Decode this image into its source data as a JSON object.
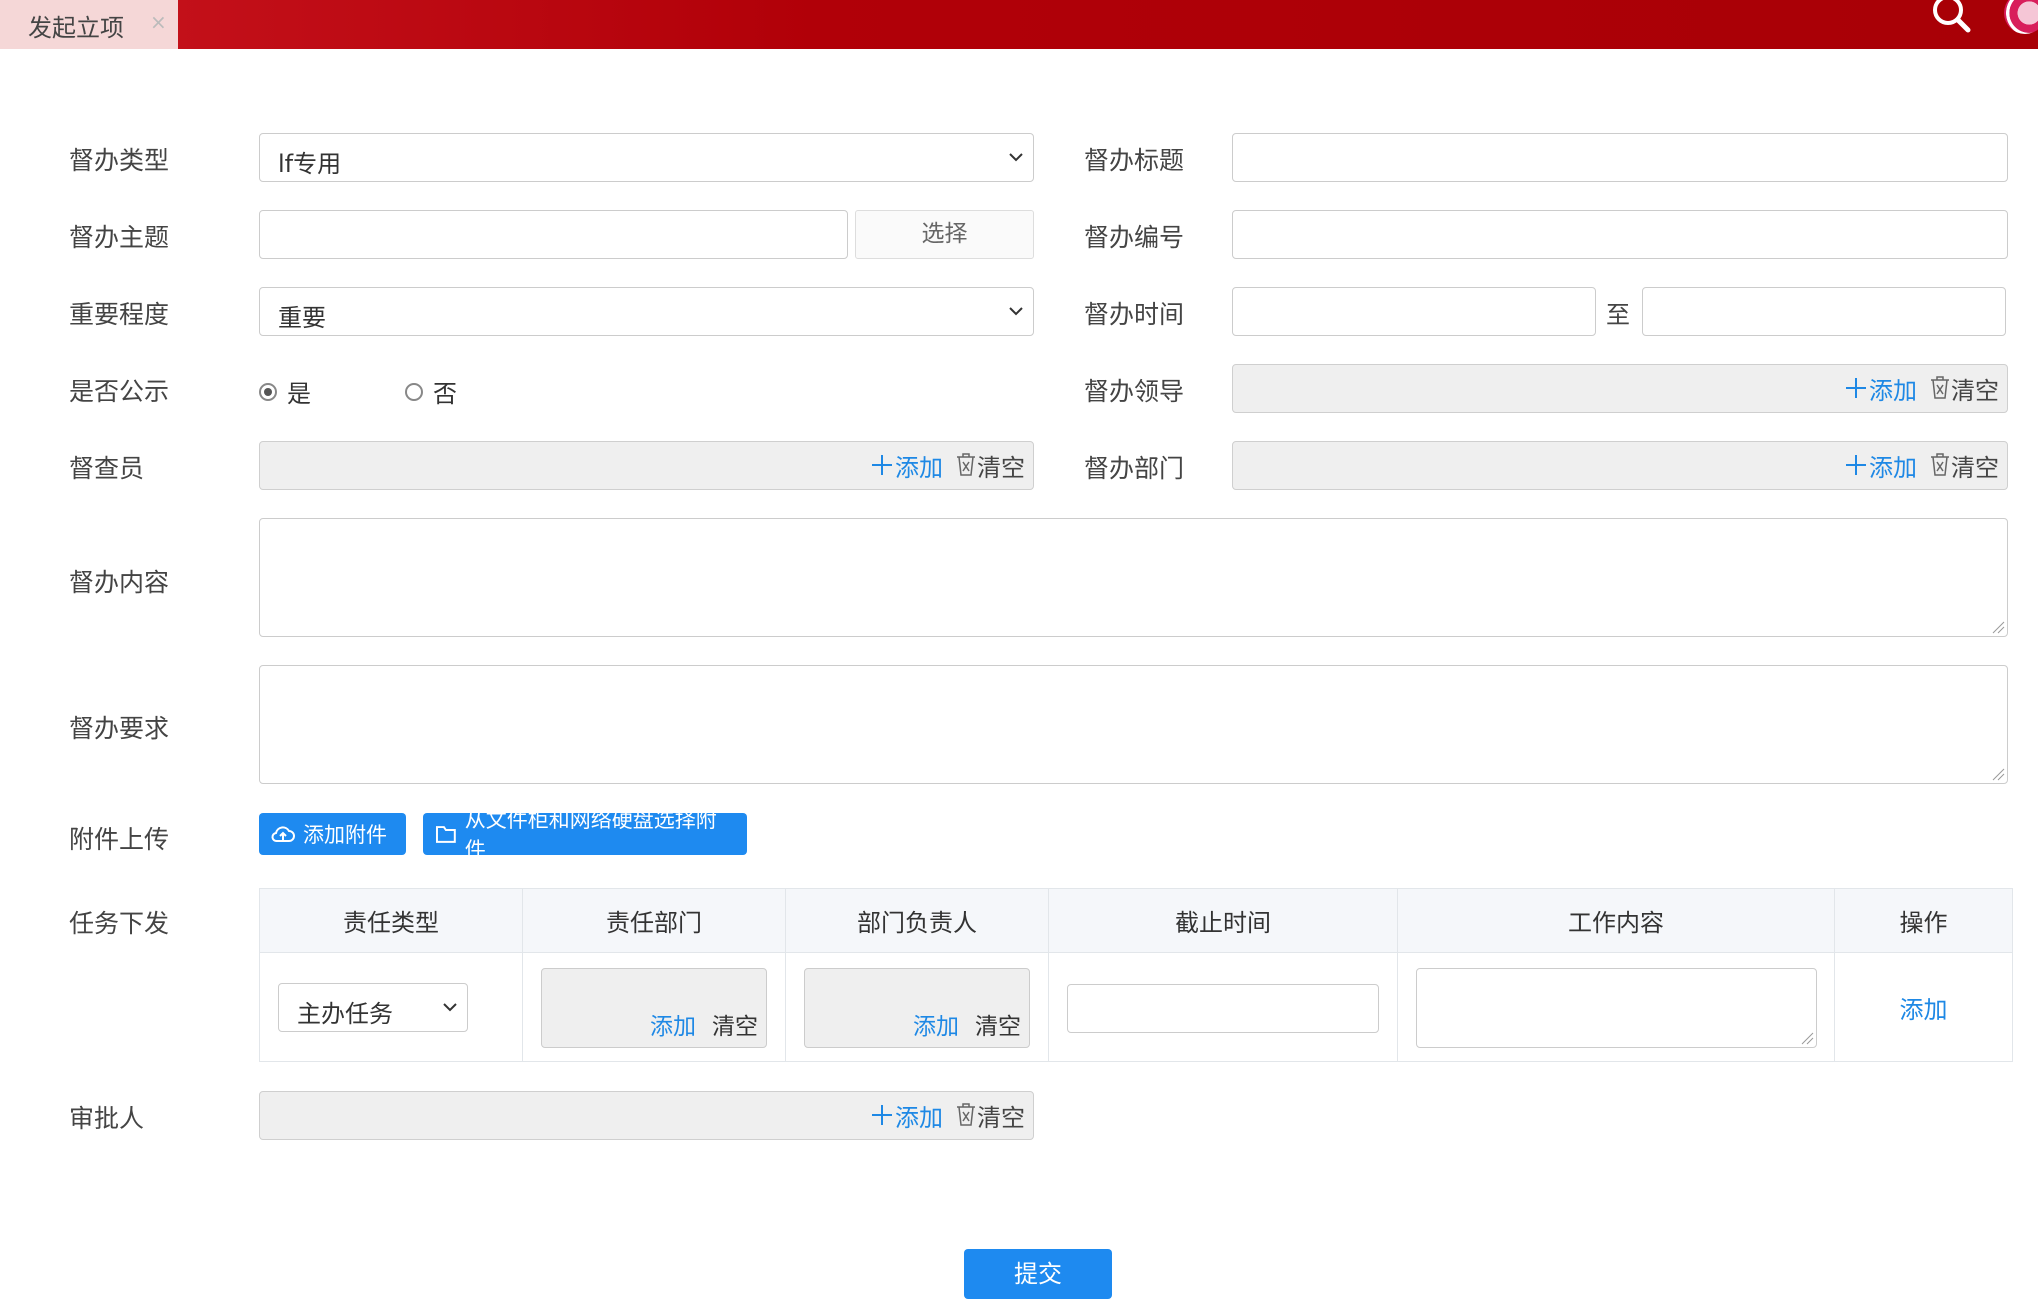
{
  "tab": {
    "title": "发起立项",
    "close": "×"
  },
  "form": {
    "type_label": "督办类型",
    "type_value": "lf专用",
    "title_label": "督办标题",
    "subject_label": "督办主题",
    "choose_label": "选择",
    "number_label": "督办编号",
    "importance_label": "重要程度",
    "importance_value": "重要",
    "time_label": "督办时间",
    "time_to": "至",
    "public_label": "是否公示",
    "public_yes": "是",
    "public_no": "否",
    "leader_label": "督办领导",
    "inspector_label": "督查员",
    "dept_label": "督办部门",
    "content_label": "督办内容",
    "requirement_label": "督办要求",
    "attach_label": "附件上传",
    "attach_add": "添加附件",
    "attach_select": "从文件柜和网络硬盘选择附件",
    "task_label": "任务下发",
    "approver_label": "审批人",
    "add": "添加",
    "clear": "清空"
  },
  "task_table": {
    "headers": [
      "责任类型",
      "责任部门",
      "部门负责人",
      "截止时间",
      "工作内容",
      "操作"
    ],
    "row": {
      "type": "主办任务",
      "add": "添加",
      "clear": "清空",
      "op": "添加"
    }
  },
  "submit": "提交",
  "colors": {
    "topbar": "#b10008",
    "accent": "#1e8af0",
    "tab_bg": "#f5d7d7"
  }
}
